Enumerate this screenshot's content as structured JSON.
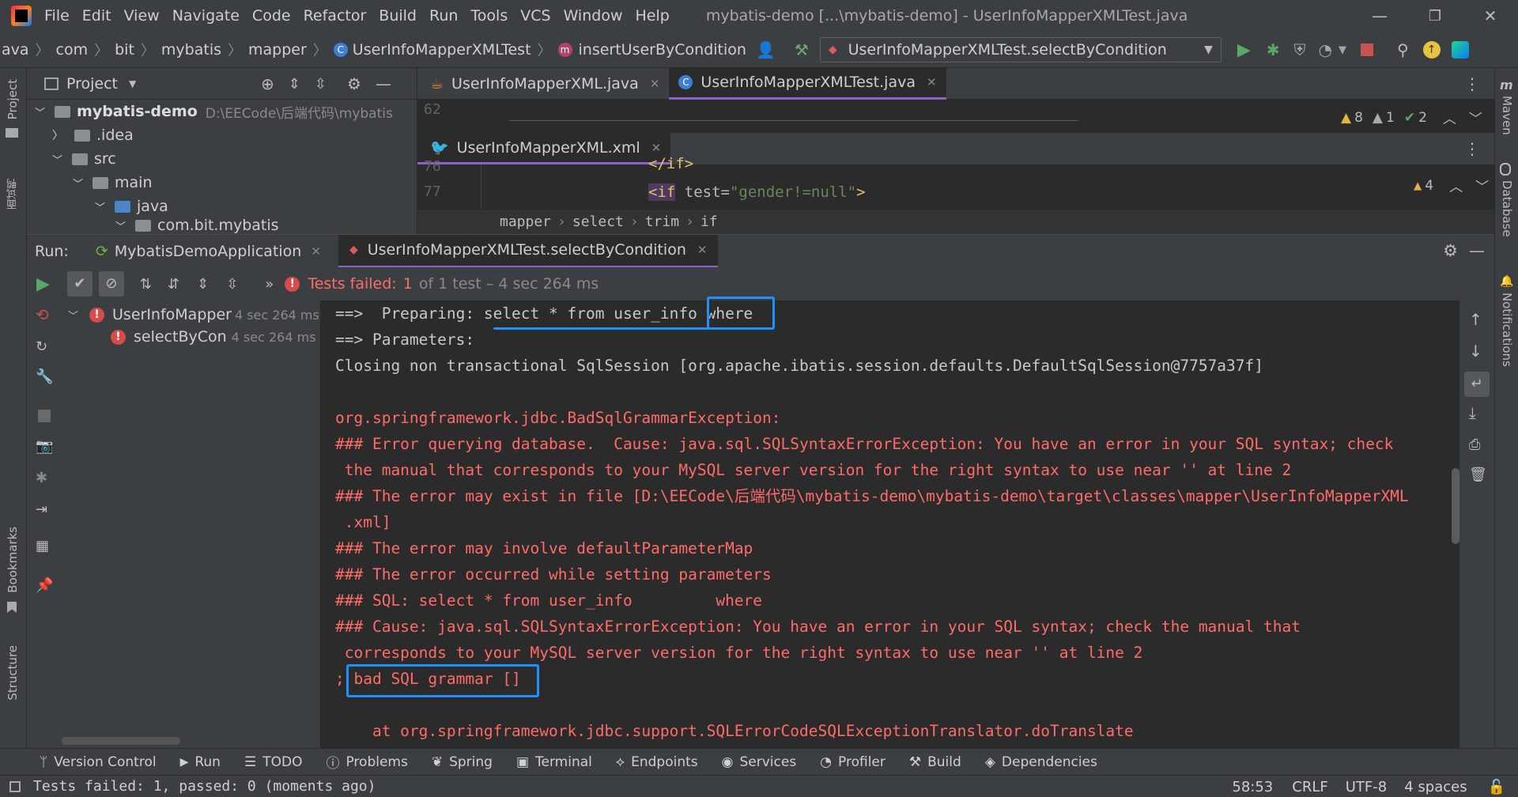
{
  "title_bar": {
    "menu": [
      "File",
      "Edit",
      "View",
      "Navigate",
      "Code",
      "Refactor",
      "Build",
      "Run",
      "Tools",
      "VCS",
      "Window",
      "Help"
    ],
    "window_title": "mybatis-demo [...\\mybatis-demo] - UserInfoMapperXMLTest.java"
  },
  "nav_bar": {
    "crumbs": [
      "ava",
      "com",
      "bit",
      "mybatis",
      "mapper",
      "UserInfoMapperXMLTest",
      "insertUserByCondition"
    ],
    "run_config": "UserInfoMapperXMLTest.selectByCondition"
  },
  "project": {
    "title": "Project",
    "root_name": "mybatis-demo",
    "root_path": "D:\\EECode\\后端代码\\mybatis",
    "items": [
      ".idea",
      "src",
      "main",
      "java",
      "com.bit.mybatis"
    ]
  },
  "left_strip": {
    "project": "Project",
    "bookmarks": "Bookmarks",
    "structure": "Structure",
    "cn_label": "面试鸭"
  },
  "right_strip": {
    "maven": "Maven",
    "database": "Database",
    "notifications": "Notifications"
  },
  "editor": {
    "tabs": [
      "UserInfoMapperXML.java",
      "UserInfoMapperXMLTest.java"
    ],
    "line1": "62",
    "warn_counts": {
      "w1": "8",
      "w2": "1",
      "ok": "2"
    },
    "xml_tab": "UserInfoMapperXML.xml",
    "lines": [
      {
        "num": "76",
        "code": "</if>"
      },
      {
        "num": "77",
        "tag": "<if",
        "attr": " test=",
        "val": "\"gender!=null\"",
        "end": ">"
      }
    ],
    "xml_warn": "4",
    "crumbs": [
      "mapper",
      "select",
      "trim",
      "if"
    ]
  },
  "run": {
    "label": "Run:",
    "tabs": [
      "MybatisDemoApplication",
      "UserInfoMapperXMLTest.selectByCondition"
    ],
    "summary_prefix": "Tests failed:",
    "summary_count": "1",
    "summary_rest": "of 1 test – 4 sec 264 ms",
    "tests": [
      {
        "name": "UserInfoMapper",
        "time": "4 sec 264 ms"
      },
      {
        "name": "selectByCon",
        "time": "4 sec 264 ms"
      }
    ],
    "console": [
      {
        "c": "gray",
        "t": "==>  Preparing: select * from user_info where"
      },
      {
        "c": "gray",
        "t": "==> Parameters: "
      },
      {
        "c": "gray",
        "t": "Closing non transactional SqlSession [org.apache.ibatis.session.defaults.DefaultSqlSession@7757a37f]"
      },
      {
        "c": "gray",
        "t": ""
      },
      {
        "c": "red",
        "t": "org.springframework.jdbc.BadSqlGrammarException: "
      },
      {
        "c": "red",
        "t": "### Error querying database.  Cause: java.sql.SQLSyntaxErrorException: You have an error in your SQL syntax; check"
      },
      {
        "c": "red",
        "t": " the manual that corresponds to your MySQL server version for the right syntax to use near '' at line 2"
      },
      {
        "c": "red",
        "t": "### The error may exist in file [D:\\EECode\\后端代码\\mybatis-demo\\mybatis-demo\\target\\classes\\mapper\\UserInfoMapperXML"
      },
      {
        "c": "red",
        "t": " .xml]"
      },
      {
        "c": "red",
        "t": "### The error may involve defaultParameterMap"
      },
      {
        "c": "red",
        "t": "### The error occurred while setting parameters"
      },
      {
        "c": "red",
        "t": "### SQL: select * from user_info         where"
      },
      {
        "c": "red",
        "t": "### Cause: java.sql.SQLSyntaxErrorException: You have an error in your SQL syntax; check the manual that"
      },
      {
        "c": "red",
        "t": " corresponds to your MySQL server version for the right syntax to use near '' at line 2"
      },
      {
        "c": "red",
        "t": "; bad SQL grammar []"
      },
      {
        "c": "red",
        "t": ""
      },
      {
        "c": "red",
        "t": "    at org.springframework.jdbc.support.SQLErrorCodeSQLExceptionTranslator.doTranslate"
      }
    ]
  },
  "bottom_tabs": [
    "Version Control",
    "Run",
    "TODO",
    "Problems",
    "Spring",
    "Terminal",
    "Endpoints",
    "Services",
    "Profiler",
    "Build",
    "Dependencies"
  ],
  "status": {
    "message": "Tests failed: 1, passed: 0 (moments ago)",
    "position": "58:53",
    "line_sep": "CRLF",
    "encoding": "UTF-8",
    "indent": "4 spaces"
  },
  "colors": {
    "highlight": "#1e90ff",
    "error": "#ff6b68",
    "accent": "#8a63c7"
  }
}
